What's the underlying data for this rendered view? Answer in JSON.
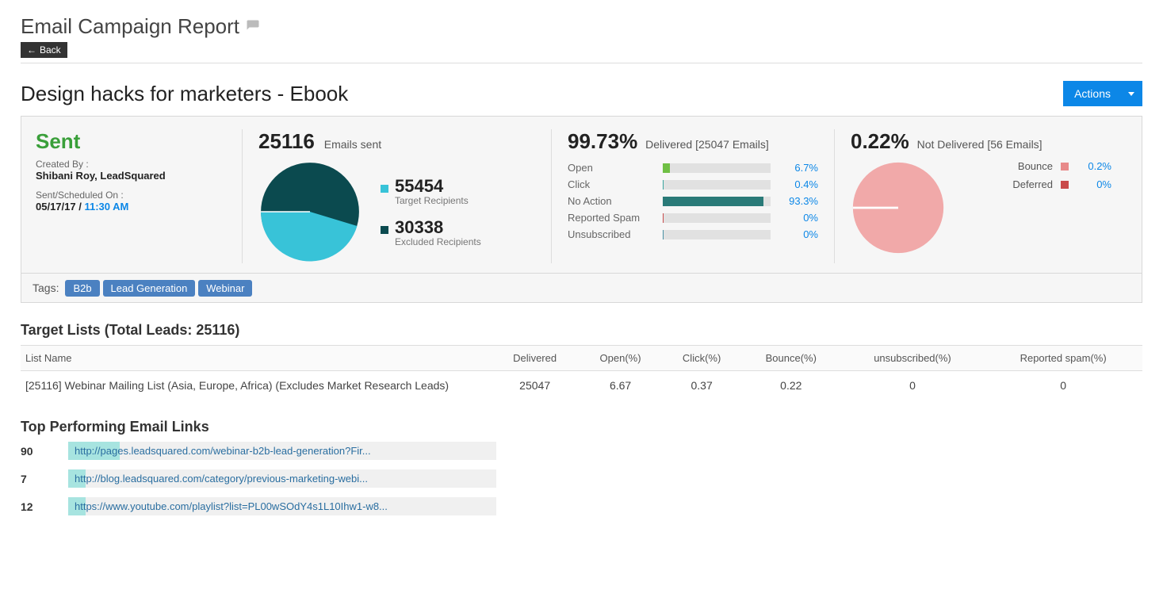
{
  "header": {
    "page_title": "Email Campaign Report",
    "back_label": "Back"
  },
  "campaign": {
    "title": "Design hacks for marketers - Ebook",
    "actions_label": "Actions",
    "status": "Sent",
    "created_by_label": "Created By :",
    "created_by_value": "Shibani Roy, LeadSquared",
    "sent_on_label": "Sent/Scheduled On :",
    "sent_on_date": "05/17/17",
    "sent_on_time": "11:30 AM"
  },
  "emails_sent": {
    "count": "25116",
    "label": "Emails sent",
    "target_recipients": {
      "value": "55454",
      "label": "Target Recipients"
    },
    "excluded_recipients": {
      "value": "30338",
      "label": "Excluded Recipients"
    }
  },
  "delivered": {
    "percent": "99.73%",
    "label": "Delivered [25047 Emails]",
    "rows": [
      {
        "label": "Open",
        "pct": "6.7%"
      },
      {
        "label": "Click",
        "pct": "0.4%"
      },
      {
        "label": "No Action",
        "pct": "93.3%"
      },
      {
        "label": "Reported Spam",
        "pct": "0%"
      },
      {
        "label": "Unsubscribed",
        "pct": "0%"
      }
    ]
  },
  "not_delivered": {
    "percent": "0.22%",
    "label": "Not Delivered [56 Emails]",
    "rows": [
      {
        "label": "Bounce",
        "pct": "0.2%"
      },
      {
        "label": "Deferred",
        "pct": "0%"
      }
    ]
  },
  "tags": {
    "label": "Tags:",
    "items": [
      "B2b",
      "Lead Generation",
      "Webinar"
    ]
  },
  "target_lists": {
    "title": "Target Lists (Total Leads: 25116)",
    "columns": [
      "List Name",
      "Delivered",
      "Open(%)",
      "Click(%)",
      "Bounce(%)",
      "unsubscribed(%)",
      "Reported spam(%)"
    ],
    "rows": [
      {
        "name": "[25116] Webinar Mailing List (Asia, Europe, Africa) (Excludes Market Research Leads)",
        "delivered": "25047",
        "open": "6.67",
        "click": "0.37",
        "bounce": "0.22",
        "unsub": "0",
        "spam": "0"
      }
    ]
  },
  "top_links": {
    "title": "Top Performing Email Links",
    "rows": [
      {
        "count": "90",
        "url": "http://pages.leadsquared.com/webinar-b2b-lead-generation?Fir..."
      },
      {
        "count": "7",
        "url": "http://blog.leadsquared.com/category/previous-marketing-webi..."
      },
      {
        "count": "12",
        "url": "https://www.youtube.com/playlist?list=PL00wSOdY4s1L10Ihw1-w8..."
      }
    ]
  },
  "colors": {
    "target": "#38c3d8",
    "excluded": "#0b4a4f",
    "open": "#6fbf44",
    "click": "#3aa5a0",
    "noaction": "#2a7a78",
    "spam": "#c94b4b",
    "unsub": "#4a90a4",
    "bounce": "#e88a8a",
    "deferred": "#c94b4b",
    "pie_notdel": "#f1a9a9"
  },
  "chart_data": [
    {
      "type": "pie",
      "title": "Emails sent breakdown",
      "series": [
        {
          "name": "Excluded Recipients",
          "value": 30338
        },
        {
          "name": "Target Recipients (Sent)",
          "value": 25116
        }
      ],
      "total_target_recipients": 55454
    },
    {
      "type": "bar",
      "title": "Delivered engagement %",
      "categories": [
        "Open",
        "Click",
        "No Action",
        "Reported Spam",
        "Unsubscribed"
      ],
      "values": [
        6.7,
        0.4,
        93.3,
        0,
        0
      ],
      "ylim": [
        0,
        100
      ],
      "unit": "%"
    },
    {
      "type": "pie",
      "title": "Not Delivered breakdown",
      "series": [
        {
          "name": "Bounce",
          "value": 0.2
        },
        {
          "name": "Deferred",
          "value": 0
        }
      ],
      "unit": "%"
    },
    {
      "type": "bar",
      "title": "Top Performing Email Links (click counts)",
      "categories": [
        "http://pages.leadsquared.com/webinar-b2b-lead-generation?Fir...",
        "http://blog.leadsquared.com/category/previous-marketing-webi...",
        "https://www.youtube.com/playlist?list=PL00wSOdY4s1L10Ihw1-w8..."
      ],
      "values": [
        90,
        7,
        12
      ]
    }
  ]
}
